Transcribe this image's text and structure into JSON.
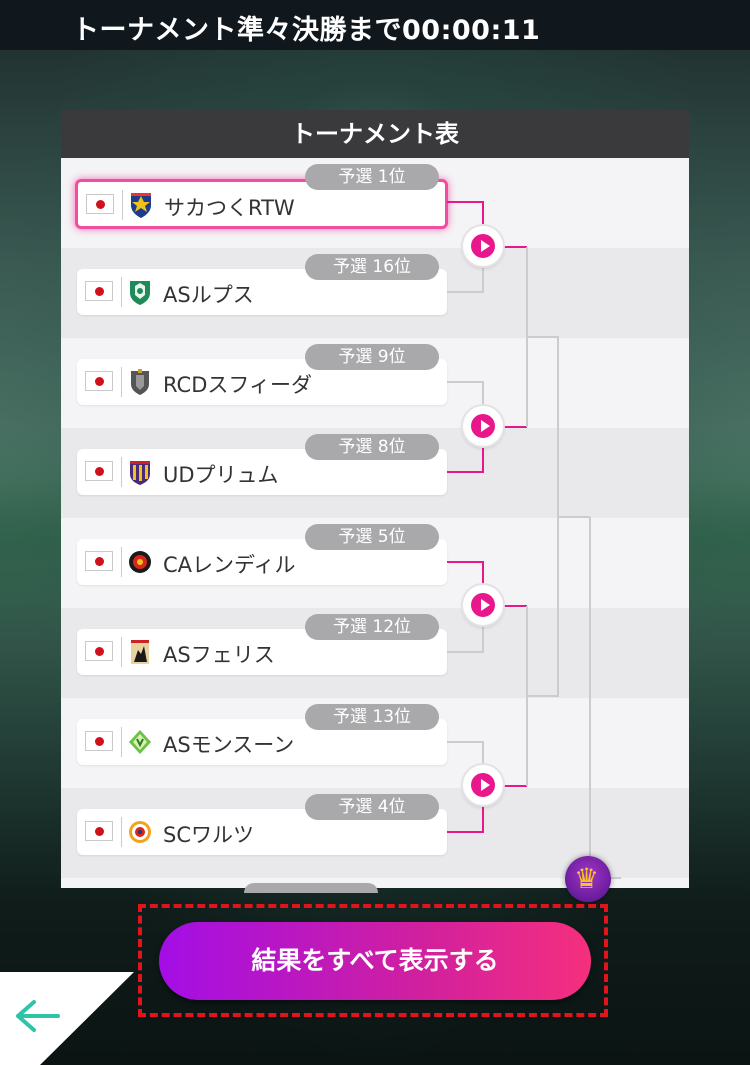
{
  "header": {
    "title_prefix": "トーナメント準々決勝まで",
    "countdown": "00:00:11"
  },
  "panel": {
    "title": "トーナメント表"
  },
  "teams": [
    {
      "name": "サカつくRTW",
      "rank": "予選 1位",
      "emblem": "navy-shield",
      "highlighted": true
    },
    {
      "name": "ASルプス",
      "rank": "予選 16位",
      "emblem": "green-wolf-shield"
    },
    {
      "name": "RCDスフィーダ",
      "rank": "予選 9位",
      "emblem": "gray-crest"
    },
    {
      "name": "UDプリュム",
      "rank": "予選 8位",
      "emblem": "purple-yellow-stripes"
    },
    {
      "name": "CAレンディル",
      "rank": "予選 5位",
      "emblem": "black-red-round"
    },
    {
      "name": "ASフェリス",
      "rank": "予選 12位",
      "emblem": "beige-black-cat"
    },
    {
      "name": "ASモンスーン",
      "rank": "予選 13位",
      "emblem": "green-diamond"
    },
    {
      "name": "SCワルツ",
      "rank": "予選 4位",
      "emblem": "orange-red-round"
    }
  ],
  "colors": {
    "accent_pink": "#e8188c",
    "button_gradient_start": "#a30ee6",
    "button_gradient_end": "#f52f7d",
    "focus_outline": "#e0141a",
    "back_arrow": "#2fc4a8"
  },
  "actions": {
    "show_all_label": "結果をすべて表示する"
  },
  "icons": {
    "match_play": "play-icon",
    "winner": "crown-icon",
    "back": "arrow-left-icon"
  }
}
